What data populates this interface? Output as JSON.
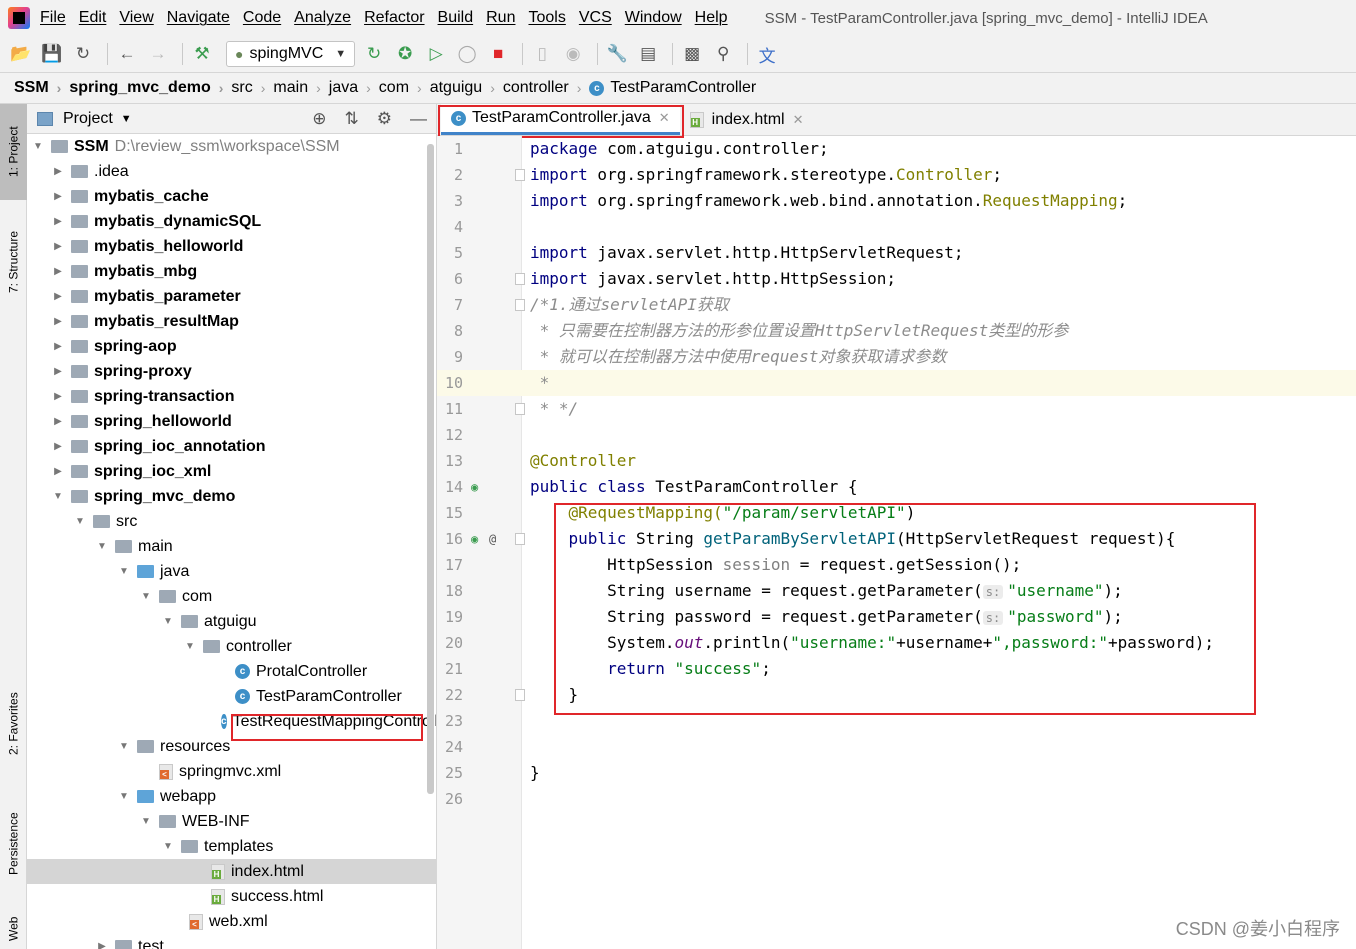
{
  "menubar": {
    "items": [
      "File",
      "Edit",
      "View",
      "Navigate",
      "Code",
      "Analyze",
      "Refactor",
      "Build",
      "Run",
      "Tools",
      "VCS",
      "Window",
      "Help"
    ],
    "title": "SSM - TestParamController.java [spring_mvc_demo] - IntelliJ IDEA"
  },
  "toolbar": {
    "run_config": "spingMVC"
  },
  "breadcrumb": [
    "SSM",
    "spring_mvc_demo",
    "src",
    "main",
    "java",
    "com",
    "atguigu",
    "controller",
    "TestParamController"
  ],
  "side_tabs": {
    "project": "1: Project",
    "structure": "7: Structure",
    "favorites": "2: Favorites",
    "persistence": "Persistence",
    "web": "Web"
  },
  "project_panel": {
    "title": "Project",
    "tree": [
      {
        "label": "SSM",
        "hint": "D:\\review_ssm\\workspace\\SSM",
        "bold": true
      },
      {
        "label": ".idea"
      },
      {
        "label": "mybatis_cache",
        "bold": true
      },
      {
        "label": "mybatis_dynamicSQL",
        "bold": true
      },
      {
        "label": "mybatis_helloworld",
        "bold": true
      },
      {
        "label": "mybatis_mbg",
        "bold": true
      },
      {
        "label": "mybatis_parameter",
        "bold": true
      },
      {
        "label": "mybatis_resultMap",
        "bold": true
      },
      {
        "label": "spring-aop",
        "bold": true
      },
      {
        "label": "spring-proxy",
        "bold": true
      },
      {
        "label": "spring-transaction",
        "bold": true
      },
      {
        "label": "spring_helloworld",
        "bold": true
      },
      {
        "label": "spring_ioc_annotation",
        "bold": true
      },
      {
        "label": "spring_ioc_xml",
        "bold": true
      },
      {
        "label": "spring_mvc_demo",
        "bold": true
      },
      {
        "label": "src"
      },
      {
        "label": "main"
      },
      {
        "label": "java"
      },
      {
        "label": "com"
      },
      {
        "label": "atguigu"
      },
      {
        "label": "controller"
      },
      {
        "label": "ProtalController"
      },
      {
        "label": "TestParamController"
      },
      {
        "label": "TestRequestMappingController"
      },
      {
        "label": "resources"
      },
      {
        "label": "springmvc.xml"
      },
      {
        "label": "webapp"
      },
      {
        "label": "WEB-INF"
      },
      {
        "label": "templates"
      },
      {
        "label": "index.html"
      },
      {
        "label": "success.html"
      },
      {
        "label": "web.xml"
      },
      {
        "label": "test"
      }
    ]
  },
  "editor": {
    "tabs": [
      {
        "label": "TestParamController.java",
        "active": true
      },
      {
        "label": "index.html",
        "active": false
      }
    ],
    "code": {
      "l1_a": "package",
      "l1_b": " com.atguigu.controller;",
      "l2_a": "import",
      "l2_b": " org.springframework.stereotype.",
      "l2_c": "Controller",
      "l2_d": ";",
      "l3_a": "import",
      "l3_b": " org.springframework.web.bind.annotation.",
      "l3_c": "RequestMapping",
      "l3_d": ";",
      "l5_a": "import",
      "l5_b": " javax.servlet.http.HttpServletRequest;",
      "l6_a": "import",
      "l6_b": " javax.servlet.http.HttpSession;",
      "l7": "/*1.通过servletAPI获取",
      "l8": " * 只需要在控制器方法的形参位置设置HttpServletRequest类型的形参",
      "l9": " * 就可以在控制器方法中使用request对象获取请求参数",
      "l10": " *",
      "l11": " * */",
      "l13": "@Controller",
      "l14_a": "public class",
      "l14_b": " TestParamController {",
      "l15_a": "    @RequestMapping(",
      "l15_b": "\"/param/servletAPI\"",
      "l15_c": ")",
      "l16_a": "    public",
      "l16_b": " String ",
      "l16_c": "getParamByServletAPI",
      "l16_d": "(HttpServletRequest request){",
      "l17_a": "        HttpSession ",
      "l17_b": "session",
      "l17_c": " = request.getSession();",
      "l18_a": "        String username = request.getParameter(",
      "l18_hint": "s:",
      "l18_b": "\"username\"",
      "l18_c": ");",
      "l19_a": "        String password = request.getParameter(",
      "l19_hint": "s:",
      "l19_b": "\"password\"",
      "l19_c": ");",
      "l20_a": "        System.",
      "l20_b": "out",
      "l20_c": ".println(",
      "l20_d": "\"username:\"",
      "l20_e": "+username+",
      "l20_f": "\",password:\"",
      "l20_g": "+password);",
      "l21_a": "        return",
      "l21_b": " \"success\"",
      "l21_c": ";",
      "l22": "    }",
      "l25": "}"
    },
    "line_numbers": [
      "1",
      "2",
      "3",
      "4",
      "5",
      "6",
      "7",
      "8",
      "9",
      "10",
      "11",
      "12",
      "13",
      "14",
      "15",
      "16",
      "17",
      "18",
      "19",
      "20",
      "21",
      "22",
      "23",
      "24",
      "25",
      "26"
    ]
  },
  "watermark": "CSDN @姜小白程序"
}
